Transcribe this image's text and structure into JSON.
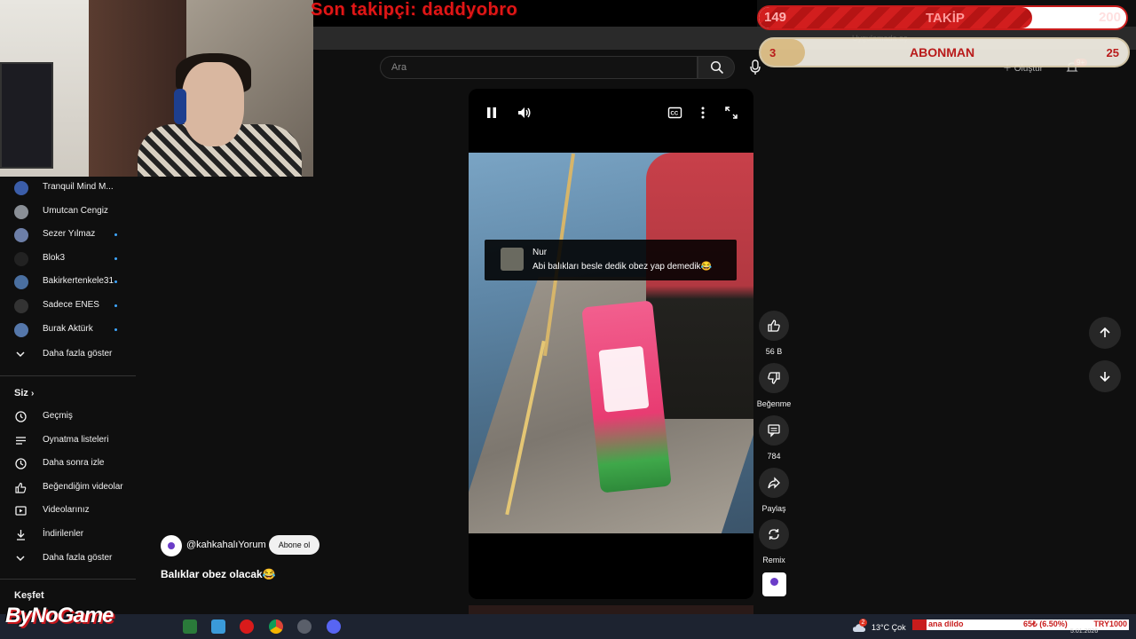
{
  "overlay": {
    "follower_text": "Son takipçi: daddyobro",
    "follow_goal": {
      "current": "149",
      "label": "TAKİP",
      "max": "200",
      "progress": 0.745
    },
    "sub_goal": {
      "current": "3",
      "label": "ABONMAN",
      "max": "25",
      "progress": 0.12
    },
    "logo": "ByNoGame"
  },
  "browser": {
    "app_label": "Uygulamada aç"
  },
  "header": {
    "search_placeholder": "Ara",
    "create_label": "Oluştur",
    "notif_badge": "9+"
  },
  "sidebar": {
    "subscriptions": [
      {
        "name": "Tranquil Mind M...",
        "color": "#3b5da8",
        "dot": false
      },
      {
        "name": "Umutcan Cengiz",
        "color": "#8a8f96",
        "dot": false
      },
      {
        "name": "Sezer Yılmaz",
        "color": "#6d7fa8",
        "dot": true
      },
      {
        "name": "Blok3",
        "color": "#222222",
        "dot": true
      },
      {
        "name": "Bakirkertenkele31",
        "color": "#4a6fa0",
        "dot": true
      },
      {
        "name": "Sadece ENES",
        "color": "#333333",
        "dot": true
      },
      {
        "name": "Burak Aktürk",
        "color": "#5577aa",
        "dot": true
      }
    ],
    "show_more_1": "Daha fazla göster",
    "you_heading": "Siz",
    "you_items": [
      {
        "name": "Geçmiş",
        "icon": "history-icon"
      },
      {
        "name": "Oynatma listeleri",
        "icon": "playlists-icon"
      },
      {
        "name": "Daha sonra izle",
        "icon": "watch-later-icon"
      },
      {
        "name": "Beğendiğim videolar",
        "icon": "liked-icon"
      },
      {
        "name": "Videolarınız",
        "icon": "your-videos-icon"
      },
      {
        "name": "İndirilenler",
        "icon": "download-icon"
      }
    ],
    "show_more_2": "Daha fazla göster",
    "explore_heading": "Keşfet"
  },
  "video": {
    "comment_author": "Nur",
    "comment_text": "Abi balıkları besle dedik obez yap demedik😂",
    "channel_handle": "@kahkahalıYorum",
    "subscribe_label": "Abone ol",
    "title": "Balıklar obez olacak😂"
  },
  "actions": {
    "likes": "56 B",
    "dislike_label": "Beğenme",
    "comments": "784",
    "share_label": "Paylaş",
    "remix_label": "Remix"
  },
  "taskbar": {
    "weather": "13°C  Çok",
    "ticker_1": "ana dildo",
    "ticker_2": "65₺ (6.50%)",
    "ticker_3": "TRY1000",
    "date": "5.01.2026",
    "weather_badge": "2"
  },
  "colors": {
    "brand_red": "#c81c1c",
    "accent_blue": "#3ea6ff",
    "background": "#0f0f0f"
  }
}
